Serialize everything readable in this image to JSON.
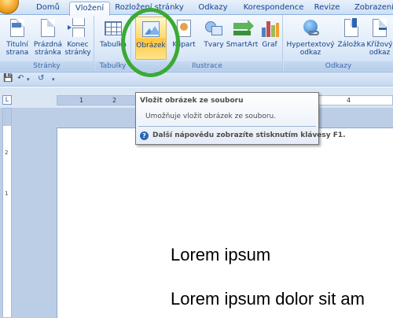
{
  "tabs": [
    {
      "label": "Domů"
    },
    {
      "label": "Vložení"
    },
    {
      "label": "Rozložení stránky"
    },
    {
      "label": "Odkazy"
    },
    {
      "label": "Korespondence"
    },
    {
      "label": "Revize"
    },
    {
      "label": "Zobrazení"
    }
  ],
  "active_tab": "Vložení",
  "ribbon": {
    "groups": [
      {
        "label": "Stránky"
      },
      {
        "label": "Tabulky"
      },
      {
        "label": "Ilustrace"
      },
      {
        "label": "Odkazy"
      }
    ],
    "buttons": {
      "titulni_strana": "Titulní\nstrana",
      "prazdna_stranka": "Prázdná\nstránka",
      "konec_stranky": "Konec\nstránky",
      "tabulka": "Tabulka",
      "obrazek": "Obrázek",
      "klipart": "Klipart",
      "tvary": "Tvary",
      "smartart": "SmartArt",
      "graf": "Graf",
      "hypertextovy_odkaz": "Hypertextový\nodkaz",
      "zalozka": "Záložka",
      "krizovy_odkaz": "Křížový\nodkaz"
    }
  },
  "tooltip": {
    "title": "Vložit obrázek ze souboru",
    "description": "Umožňuje vložit obrázek ze souboru.",
    "help": "Další nápovědu zobrazíte stisknutím klávesy F1."
  },
  "ruler": {
    "marks": [
      "1",
      "2",
      "1",
      "4"
    ]
  },
  "vertical_ruler": {
    "marks": [
      "2",
      "1"
    ]
  },
  "document": {
    "lines": [
      "Lorem ipsum",
      "Lorem ipsum dolor sit am"
    ]
  },
  "colors": {
    "highlight_ring": "#3aaa35",
    "hot_button": "#ffc53d",
    "ribbon_text": "#15428b"
  },
  "icons": {
    "save": "save-icon",
    "undo": "undo-icon",
    "redo": "redo-icon",
    "help": "help-icon"
  }
}
